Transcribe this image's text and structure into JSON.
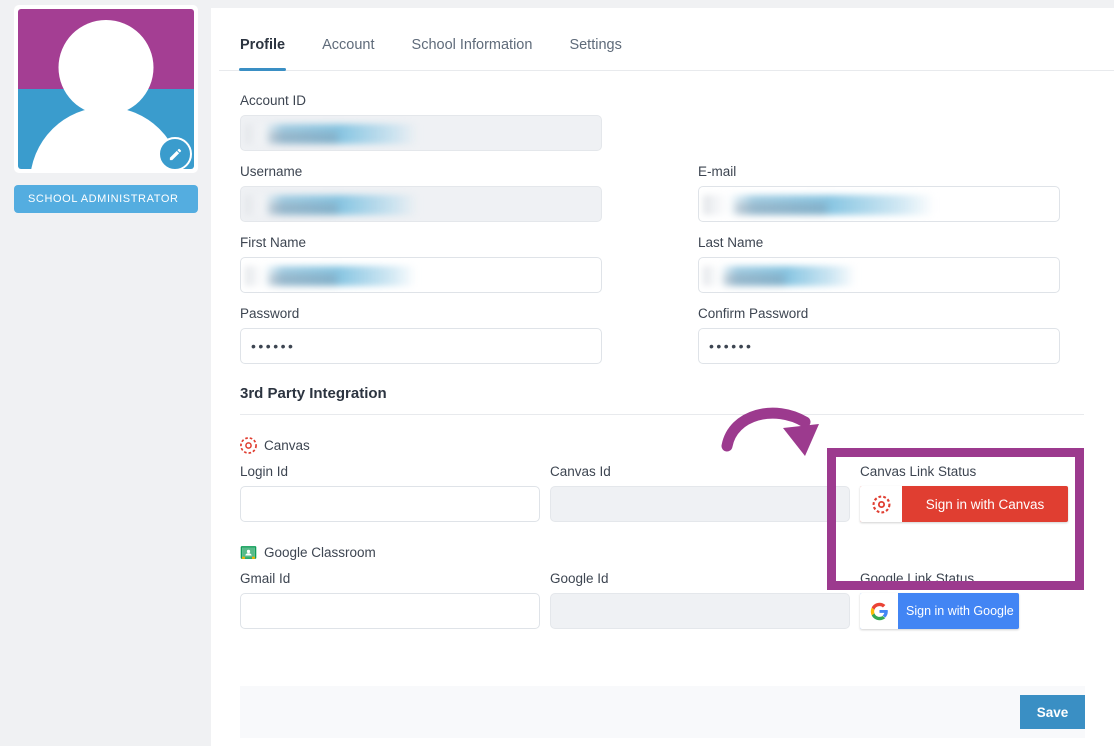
{
  "sidebar": {
    "avatar": {
      "name": "user-avatar",
      "edit_icon": "pencil-icon"
    },
    "role_badge": "SCHOOL ADMINISTRATOR"
  },
  "tabs": [
    {
      "label": "Profile",
      "active": true
    },
    {
      "label": "Account",
      "active": false
    },
    {
      "label": "School Information",
      "active": false
    },
    {
      "label": "Settings",
      "active": false
    }
  ],
  "form": {
    "account_id": {
      "label": "Account ID",
      "value": "",
      "redacted": true,
      "disabled": true
    },
    "username": {
      "label": "Username",
      "value": "",
      "redacted": true,
      "disabled": true
    },
    "email": {
      "label": "E-mail",
      "value": "",
      "redacted": true,
      "disabled": false
    },
    "first_name": {
      "label": "First Name",
      "value": "",
      "redacted": true,
      "disabled": false
    },
    "last_name": {
      "label": "Last Name",
      "value": "",
      "redacted": true,
      "disabled": false
    },
    "password": {
      "label": "Password",
      "value": "••••••"
    },
    "confirm_password": {
      "label": "Confirm Password",
      "value": "••••••"
    }
  },
  "integration": {
    "section_title": "3rd Party Integration",
    "canvas": {
      "provider": "Canvas",
      "icon": "canvas-icon",
      "login_id_label": "Login Id",
      "login_id_value": "",
      "canvas_id_label": "Canvas Id",
      "canvas_id_value": "",
      "link_status_label": "Canvas Link Status",
      "signin_button": "Sign in with Canvas",
      "button_color": "#e03e31"
    },
    "google": {
      "provider": "Google Classroom",
      "icon": "google-classroom-icon",
      "gmail_id_label": "Gmail Id",
      "gmail_id_value": "",
      "google_id_label": "Google Id",
      "google_id_value": "",
      "link_status_label": "Google Link Status",
      "signin_button": "Sign in with Google",
      "button_color": "#4285f4"
    }
  },
  "footer": {
    "save_label": "Save",
    "save_color": "#3a8fc4"
  },
  "annotations": {
    "highlight_color": "#9c3a8e",
    "arrow": "curved-arrow-pointing-to-canvas-link-status"
  }
}
